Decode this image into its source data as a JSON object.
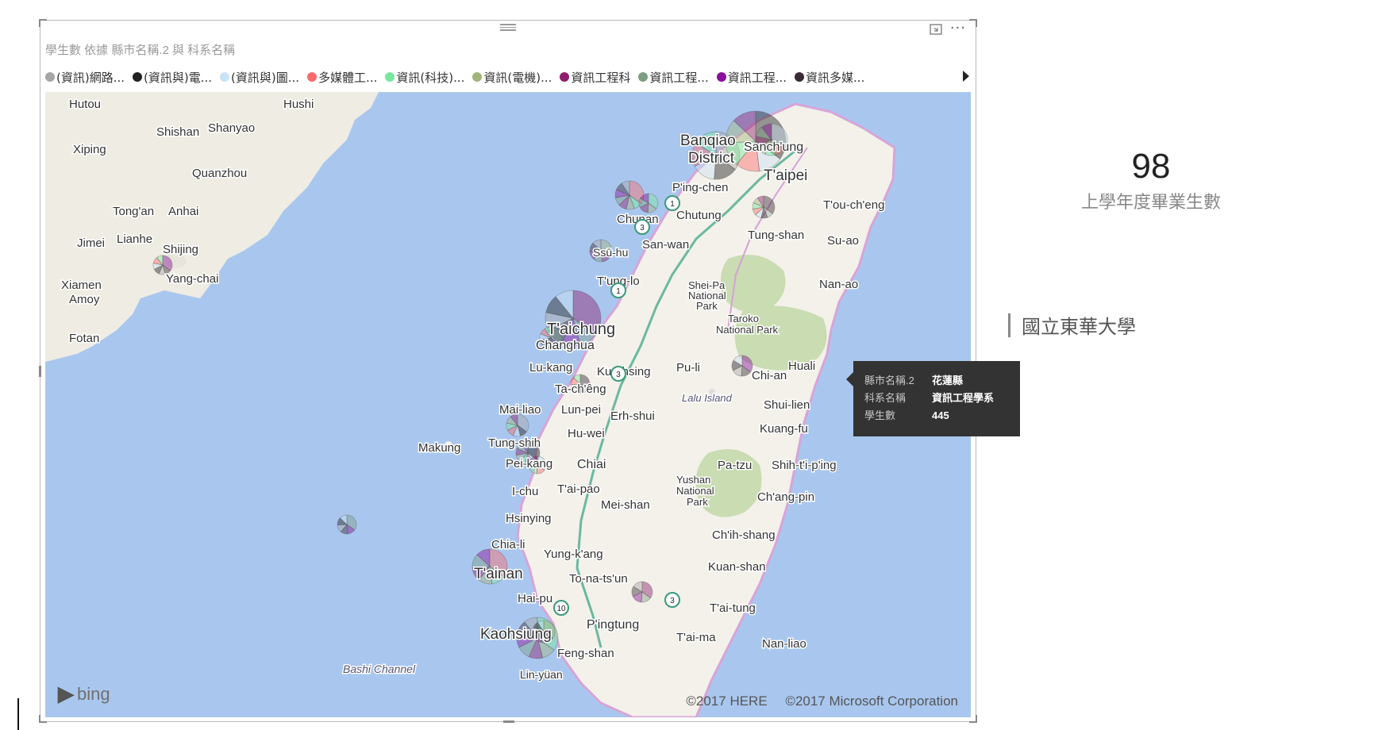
{
  "visual": {
    "title": "學生數 依據 縣市名稱.2 與 科系名稱",
    "legend": [
      {
        "label": "(資訊)網路...",
        "color": "#a6a6a6"
      },
      {
        "label": "(資訊與)電...",
        "color": "#222222"
      },
      {
        "label": "(資訊與)圖...",
        "color": "#c9e3f3"
      },
      {
        "label": "多媒體工...",
        "color": "#fd6a6a"
      },
      {
        "label": "資訊(科技)...",
        "color": "#79e89c"
      },
      {
        "label": "資訊(電機)...",
        "color": "#a3b47a"
      },
      {
        "label": "資訊工程科",
        "color": "#8f1f6e"
      },
      {
        "label": "資訊工程...",
        "color": "#7e9e84"
      },
      {
        "label": "資訊工程...",
        "color": "#8a0f9c"
      },
      {
        "label": "資訊多媒...",
        "color": "#3a2a35"
      }
    ],
    "icons": {
      "focus": "focus-mode-icon",
      "more": "more-options-icon",
      "legend_next": "chevron-right-icon"
    }
  },
  "map": {
    "places": [
      "Hutou",
      "Shishan",
      "Shanyao",
      "Hushi",
      "Xiping",
      "Quanzhou",
      "Tong'an",
      "Anhai",
      "Jimei",
      "Lianhe",
      "Shijing",
      "Yang-chai",
      "Xiamen",
      "Amoy",
      "Fotan",
      "Banqiao",
      "District",
      "Sanch'ung",
      "T'aipei",
      "P'ing-chen",
      "T'ou-ch'eng",
      "Chunan",
      "Chutung",
      "Tung-shan",
      "Su-ao",
      "San-wan",
      "Ssū-hu",
      "T'ung-lo",
      "Nan-ao",
      "Shei-Pa",
      "National",
      "Park",
      "Taroko",
      "National Park",
      "T'aichung",
      "Changhua",
      "Lu-kang",
      "Kuo-hsing",
      "Pu-li",
      "Chi-an",
      "Huali",
      "Ta-ch'êng",
      "Lalu Island",
      "Shui-lien",
      "Mai-liao",
      "Lun-pei",
      "Erh-shui",
      "Kuang-fu",
      "Hu-wei",
      "Makung",
      "Tung-shih",
      "Chiai",
      "Pei-kang",
      "Pa-tzu",
      "Shih-t'i-p'ing",
      "I-chu",
      "T'ai-pao",
      "Yushan",
      "National",
      "Park",
      "Mei-shan",
      "Ch'ang-pin",
      "Hsinying",
      "Ch'ih-shang",
      "Chia-li",
      "Yung-k'ang",
      "T'ainan",
      "To-na-ts'un",
      "Kuan-shan",
      "Hai-pu",
      "T'ai-tung",
      "P'ingtung",
      "Kaohsiung",
      "T'ai-ma",
      "Nan-liao",
      "Feng-shan",
      "Bashi Channel",
      "Lin-yüan"
    ],
    "highway_shields": [
      "3",
      "1",
      "1",
      "3",
      "3",
      "10"
    ],
    "bing_logo": "bing",
    "copyright_here": "©2017 HERE",
    "copyright_ms": "©2017 Microsoft Corporation"
  },
  "tooltip": {
    "rows": [
      {
        "key": "縣市名稱.2",
        "value": "花蓮縣"
      },
      {
        "key": "科系名稱",
        "value": "資訊工程學系"
      },
      {
        "key": "學生數",
        "value": "445"
      }
    ]
  },
  "kpi": {
    "value": "98",
    "label": "上學年度畢業生數"
  },
  "slicer": {
    "selected": "國立東華大學"
  }
}
